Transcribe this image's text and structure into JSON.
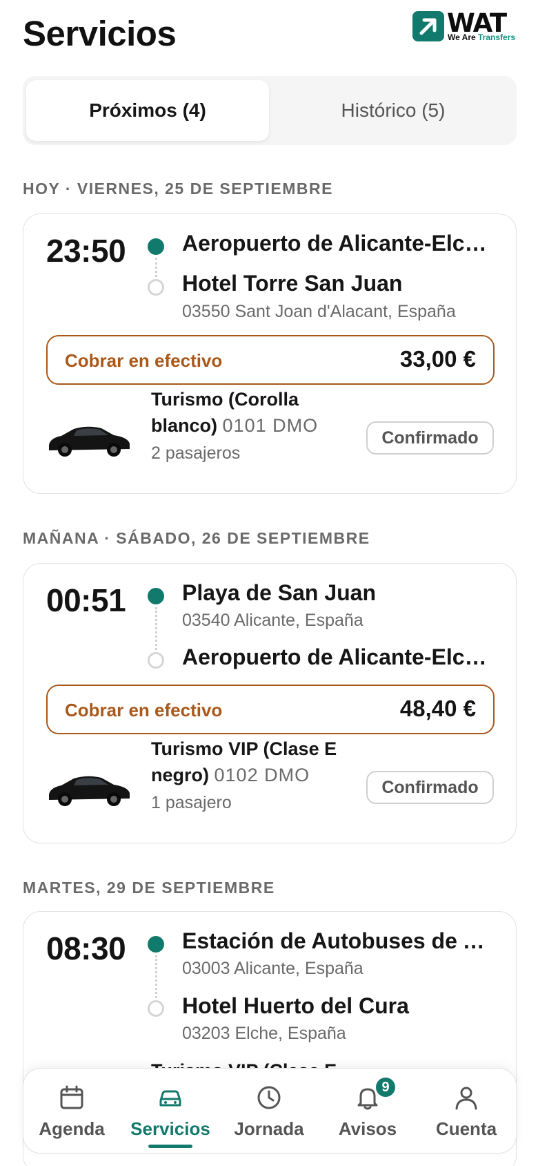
{
  "header": {
    "title": "Servicios",
    "logo_word": "WAT",
    "logo_sub_dark": "We Are ",
    "logo_sub_teal": "Transfers"
  },
  "tabs": [
    {
      "label": "Próximos (4)",
      "active": true
    },
    {
      "label": "Histórico (5)",
      "active": false
    }
  ],
  "sections": [
    {
      "label": "HOY · VIERNES, 25 DE SEPTIEMBRE",
      "service": {
        "time": "23:50",
        "origin": {
          "name": "Aeropuerto de Alicante-Elche Miguel Hernández",
          "address": ""
        },
        "destination": {
          "name": "Hotel Torre San Juan",
          "address": "03550 Sant Joan d'Alacant, España"
        },
        "payment_label": "Cobrar en efectivo",
        "amount": "33,00 €",
        "vehicle": "Turismo (Corolla",
        "vehicle_line2": "blanco)",
        "plate": "0101 DMO",
        "passengers": "2 pasajeros",
        "status": "Confirmado"
      }
    },
    {
      "label": "MAÑANA · SÁBADO, 26 DE SEPTIEMBRE",
      "service": {
        "time": "00:51",
        "origin": {
          "name": "Playa de San Juan",
          "address": "03540 Alicante, España"
        },
        "destination": {
          "name": "Aeropuerto de Alicante-Elche Miguel Hernández",
          "address": ""
        },
        "payment_label": "Cobrar en efectivo",
        "amount": "48,40 €",
        "vehicle": "Turismo VIP (Clase E",
        "vehicle_line2": "negro)",
        "plate": "0102 DMO",
        "passengers": "1 pasajero",
        "status": "Confirmado"
      }
    },
    {
      "label": "MARTES, 29 DE SEPTIEMBRE",
      "service": {
        "time": "08:30",
        "origin": {
          "name": "Estación de Autobuses de Alicante",
          "address": "03003 Alicante, España"
        },
        "destination": {
          "name": "Hotel Huerto del Cura",
          "address": "03203 Elche, España"
        },
        "vehicle": "Turismo VIP (Clase E"
      }
    }
  ],
  "bottom_nav": [
    {
      "label": "Agenda",
      "icon": "calendar-icon",
      "active": false
    },
    {
      "label": "Servicios",
      "icon": "car-icon",
      "active": true
    },
    {
      "label": "Jornada",
      "icon": "clock-icon",
      "active": false
    },
    {
      "label": "Avisos",
      "icon": "bell-icon",
      "active": false,
      "badge": "9"
    },
    {
      "label": "Cuenta",
      "icon": "user-icon",
      "active": false
    }
  ],
  "colors": {
    "brand": "#127a6c",
    "cash": "#a9581a",
    "muted": "#6a6a6a"
  }
}
